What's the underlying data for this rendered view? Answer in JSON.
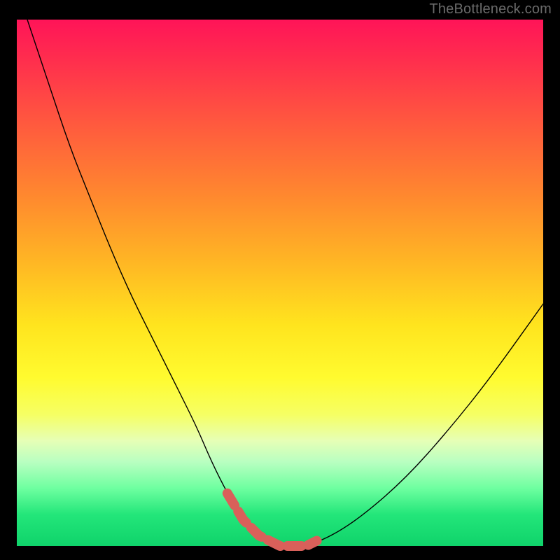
{
  "watermark": "TheBottleneck.com",
  "colors": {
    "frame": "#000000",
    "curve": "#000000",
    "highlight": "#d9605a",
    "watermark_text": "#6b6b6b"
  },
  "chart_data": {
    "type": "line",
    "title": "",
    "xlabel": "",
    "ylabel": "",
    "xlim": [
      0,
      100
    ],
    "ylim": [
      0,
      100
    ],
    "grid": false,
    "legend_position": "none",
    "series": [
      {
        "name": "bottleneck-curve",
        "x": [
          2,
          6,
          10,
          14,
          18,
          22,
          26,
          30,
          34,
          37,
          40,
          43,
          46,
          50,
          55,
          60,
          66,
          74,
          82,
          90,
          100
        ],
        "values": [
          100,
          88,
          76,
          66,
          56,
          47,
          39,
          31,
          23,
          16,
          10,
          5,
          2,
          0,
          0,
          2,
          6,
          13,
          22,
          32,
          46
        ],
        "color": "#000000"
      }
    ],
    "annotations": [
      {
        "name": "optimal-window-highlight",
        "type": "line-segment",
        "x": [
          40,
          43,
          46,
          50,
          55,
          57
        ],
        "values": [
          10,
          5,
          2,
          0,
          0,
          1
        ],
        "style": "dashed-thick",
        "color": "#d9605a"
      }
    ],
    "background_gradient": {
      "direction": "vertical",
      "stops": [
        {
          "pos": 0,
          "color": "#ff1458"
        },
        {
          "pos": 20,
          "color": "#ff5a3e"
        },
        {
          "pos": 46,
          "color": "#ffb624"
        },
        {
          "pos": 68,
          "color": "#fffb2f"
        },
        {
          "pos": 84,
          "color": "#b9ffc1"
        },
        {
          "pos": 100,
          "color": "#0fd36a"
        }
      ]
    }
  }
}
